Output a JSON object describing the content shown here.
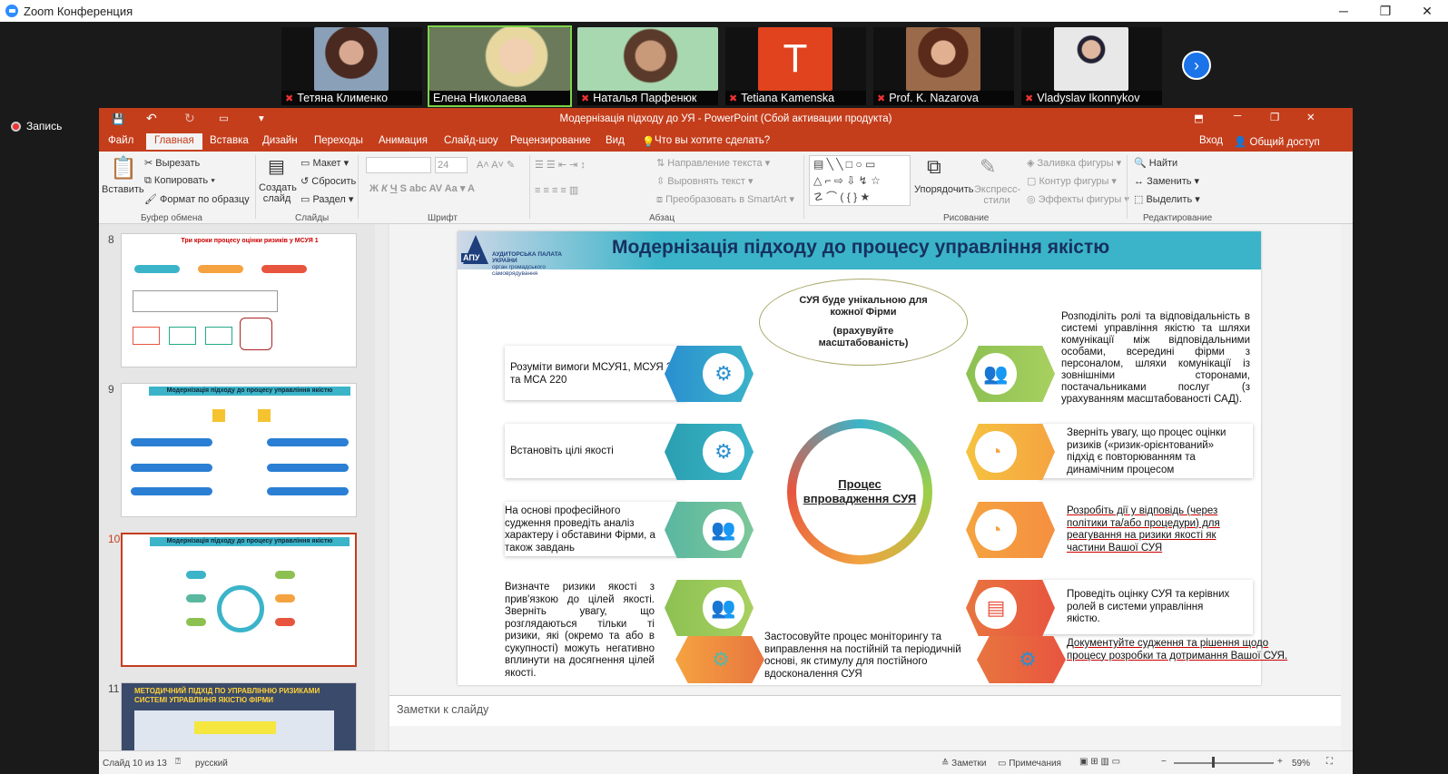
{
  "window": {
    "title": "Zoom Конференция",
    "minimize": "─",
    "maximize": "❐",
    "close": "✕"
  },
  "participants": [
    {
      "name": "Тетяна Клименко",
      "color": "#5c3a2a",
      "bg": "#8aa0b8"
    },
    {
      "name": "Елена Николаева",
      "color": "#e8c9a0",
      "bg": "#7a8a6a"
    },
    {
      "name": "Наталья Парфенюк",
      "color": "#6b4e3a",
      "bg": "#a8d8b0"
    },
    {
      "name": "Tetiana Kamenska",
      "initial": "T",
      "color": "#e0431e",
      "bg": "#e0431e"
    },
    {
      "name": "Prof. K. Nazarova",
      "color": "#c08a6a",
      "bg": "#9a6a4a"
    },
    {
      "name": "Vladyslav Ikonnykov",
      "color": "#223",
      "bg": "#e8e8e8"
    }
  ],
  "record_label": "Запись",
  "ppt": {
    "title": "Модернізація підходу до УЯ - PowerPoint (Сбой активации продукта)",
    "tabs": [
      "Файл",
      "Главная",
      "Вставка",
      "Дизайн",
      "Переходы",
      "Анимация",
      "Слайд-шоу",
      "Рецензирование",
      "Вид"
    ],
    "tell_me": "Что вы хотите сделать?",
    "signin": "Вход",
    "share": "Общий доступ",
    "ribbon": {
      "paste": "Вставить",
      "cut": "Вырезать",
      "copy": "Копировать",
      "format_painter": "Формат по образцу",
      "clipboard": "Буфер обмена",
      "new_slide": "Создать слайд",
      "layout": "Макет",
      "reset": "Сбросить",
      "section": "Раздел",
      "slides": "Слайды",
      "font_size": "24",
      "font": "Шрифт",
      "text_dir": "Направление текста",
      "align_text": "Выровнять текст",
      "smartart": "Преобразовать в SmartArt",
      "paragraph": "Абзац",
      "arrange": "Упорядочить",
      "quick_styles": "Экспресс-стили",
      "fill": "Заливка фигуры",
      "outline": "Контур фигуры",
      "effects": "Эффекты фигуры",
      "drawing": "Рисование",
      "find": "Найти",
      "replace": "Заменить",
      "select": "Выделить",
      "editing": "Редактирование"
    },
    "thumbs": [
      {
        "num": "8",
        "title": "Три кроки процесу оцінки ризиків у МСУЯ 1"
      },
      {
        "num": "9",
        "title": "Модернізація підходу до процесу управління якістю"
      },
      {
        "num": "10",
        "title": "Модернізація підходу до процесу управління якістю"
      },
      {
        "num": "11",
        "title": "МЕТОДИЧНИЙ ПІДХІД ПО УПРАВЛІННЮ РИЗИКАМИ СИСТЕМІ УПРАВЛІННЯ ЯКІСТЮ ФІРМИ"
      }
    ],
    "notes_placeholder": "Заметки к слайду",
    "status": {
      "slide": "Слайд 10 из 13",
      "lang": "русский",
      "notes": "Заметки",
      "comments": "Примечания",
      "zoom": "59%"
    }
  },
  "slide": {
    "title": "Модернізація підходу до процесу управління якістю",
    "logo_abbr": "АПУ",
    "logo_name": "АУДИТОРСЬКА ПАЛАТА УКРАЇНИ",
    "logo_sub": "орган громадського самоврядування",
    "oval_line1": "СУЯ буде унікальною для кожної Фірми",
    "oval_line2": "(врахувуйте масштабованість)",
    "center": "Процес впровадження СУЯ",
    "left": [
      "Розуміти вимоги МСУЯ1, МСУЯ 2 та МСА 220",
      "Встановіть цілі якості",
      "На основі професійного судження проведіть аналіз характеру і обставини Фірми, а також завдань",
      "Визначте ризики якості з прив'язкою до цілей якості. Зверніть увагу, що розглядаються тільки ті ризики, які (окремо та або в сукупності) можуть негативно вплинути на досягнення цілей якості."
    ],
    "bottom": "Застосовуйте процес моніторингу та виправлення на постійній та періодичній основі, як стимулу для постійного вдосконалення СУЯ",
    "right": [
      "Розподіліть ролі та відповідальність в системі управління якістю та шляхи комунікації між відповідальними особами, всередині фірми з персоналом, шляхи комунікації із зовнішніми сторонами, постачальниками послуг (з урахуванням масштабованості САД).",
      "Зверніть увагу, що процес оцінки ризиків («ризик-орієнтований» підхід є повторюванням та динамічним процесом",
      "Розробіть дії у відповідь (через політики та/або процедури) для реагування на ризики якості як частини Вашої СУЯ",
      "Проведіть оцінку СУЯ та керівних ролей в системи управління якістю.",
      "Документуйте судження та рішення щодо процесу розробки та дотримання Вашої СУЯ."
    ],
    "colors": {
      "blue": "#3bb4c9",
      "green": "#8cc152",
      "teal": "#5ab7a0",
      "orange": "#f5a340",
      "red": "#e8553f"
    }
  }
}
